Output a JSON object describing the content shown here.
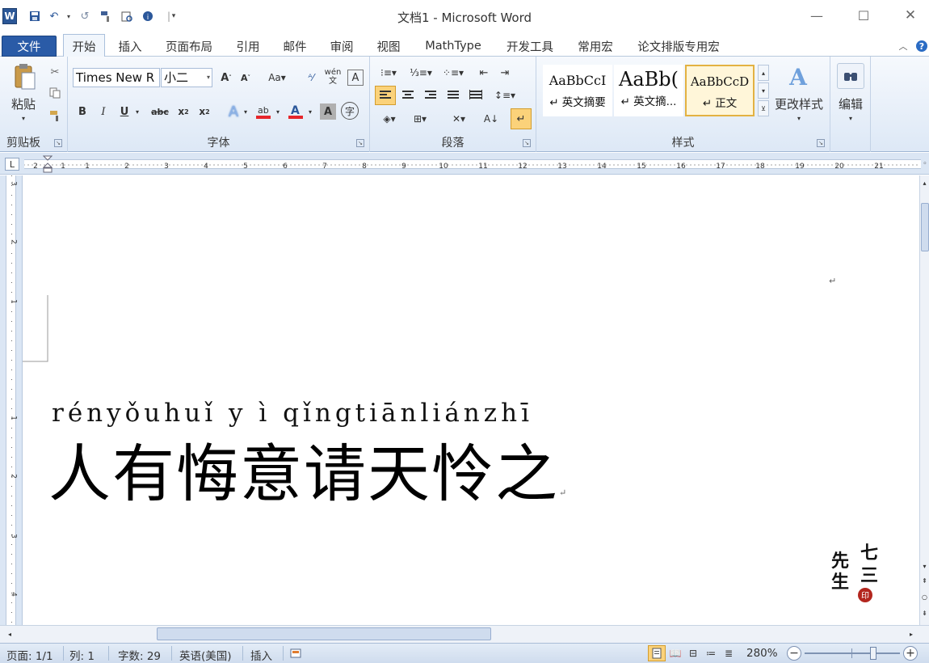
{
  "window": {
    "title": "文档1 - Microsoft Word",
    "logo": "W"
  },
  "quick_access": {
    "icons": [
      "save-icon",
      "undo-icon",
      "redo-icon",
      "format-painter-icon",
      "print-preview-icon",
      "spelling-icon",
      "customize-icon"
    ]
  },
  "menu": {
    "file": "文件",
    "tabs": [
      "开始",
      "插入",
      "页面布局",
      "引用",
      "邮件",
      "审阅",
      "视图",
      "MathType",
      "开发工具",
      "常用宏",
      "论文排版专用宏"
    ]
  },
  "ribbon": {
    "clipboard": {
      "label": "剪贴板",
      "paste_label": "粘贴"
    },
    "font": {
      "label": "字体",
      "font_name": "Times New R",
      "font_size": "小二",
      "wen_label": "wén\n文"
    },
    "paragraph": {
      "label": "段落"
    },
    "styles": {
      "label": "样式",
      "items": [
        {
          "preview": "AaBbCcI",
          "name": "↵ 英文摘要"
        },
        {
          "preview": "AaBb(",
          "name": "↵ 英文摘..."
        },
        {
          "preview": "AaBbCcD",
          "name": "↵ 正文"
        }
      ],
      "change_label": "更改样式"
    },
    "editing": {
      "label": "编辑"
    }
  },
  "ruler": {
    "h_numbers": [
      "2",
      "1",
      "",
      "1",
      "2",
      "3",
      "4",
      "5",
      "6",
      "7",
      "8",
      "9",
      "10",
      "11",
      "12",
      "13",
      "14",
      "15",
      "16",
      "17",
      "18",
      "19",
      "20",
      "21"
    ],
    "v_numbers": [
      "3",
      "2",
      "1",
      "",
      "1",
      "2",
      "3",
      "4"
    ]
  },
  "document": {
    "pinyin": "rényǒuhuǐ y ì qǐngtiānliánzhī",
    "hanzi": "人有悔意请天怜之",
    "para_mark": "↵",
    "seal_text": [
      "七",
      "三",
      "先",
      "生"
    ]
  },
  "status": {
    "page": "页面: 1/1",
    "column": "列: 1",
    "word_count": "字数: 29",
    "language": "英语(美国)",
    "mode": "插入",
    "zoom": "280%"
  }
}
